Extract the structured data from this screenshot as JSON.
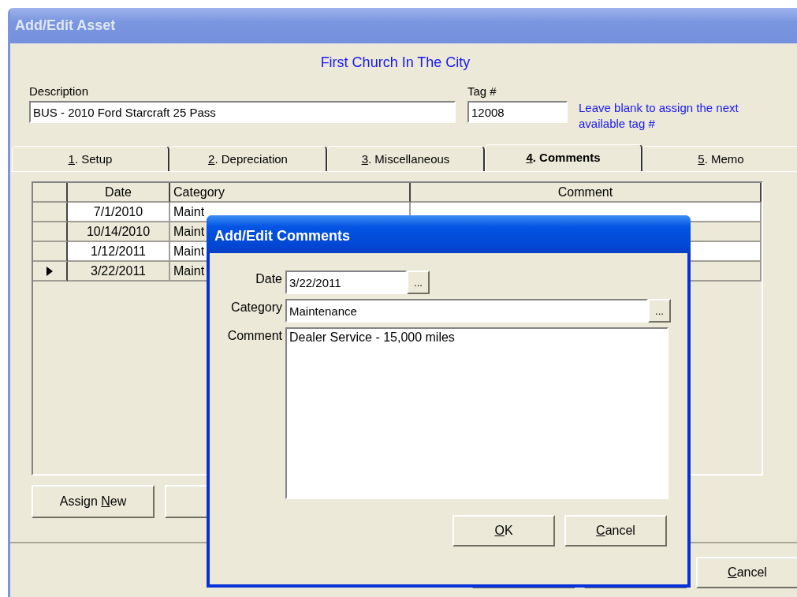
{
  "window": {
    "title": "Add/Edit Asset"
  },
  "organization": "First Church In The City",
  "description": {
    "label": "Description",
    "value": "BUS - 2010 Ford Starcraft 25 Pass"
  },
  "tag": {
    "label": "Tag #",
    "value": "12008",
    "hint": "Leave blank to assign the next available tag #"
  },
  "tabs": [
    {
      "key": "1",
      "post": ". Setup",
      "selected": false
    },
    {
      "key": "2",
      "post": ". Depreciation",
      "selected": false
    },
    {
      "key": "3",
      "post": ". Miscellaneous",
      "selected": false
    },
    {
      "key": "4",
      "post": ". Comments",
      "selected": true
    },
    {
      "key": "5",
      "post": ". Memo",
      "selected": false
    }
  ],
  "table": {
    "columns": [
      "Date",
      "Category",
      "Comment"
    ],
    "rows": [
      {
        "date": "7/1/2010",
        "category": "Maint",
        "current": false
      },
      {
        "date": "10/14/2010",
        "category": "Maint",
        "current": false
      },
      {
        "date": "1/12/2011",
        "category": "Maint",
        "current": false
      },
      {
        "date": "3/22/2011",
        "category": "Maint",
        "current": true
      }
    ]
  },
  "panel_buttons": [
    {
      "pre": "Assign ",
      "key": "N",
      "post": "ew"
    }
  ],
  "footer_buttons": [
    {
      "key": "C",
      "post": "ancel"
    }
  ],
  "dialog": {
    "title": "Add/Edit Comments",
    "date": {
      "label": "Date",
      "value": "3/22/2011",
      "button": "..."
    },
    "category": {
      "label": "Category",
      "value": "Maintenance",
      "button": "..."
    },
    "comment": {
      "label": "Comment",
      "value": "Dealer Service - 15,000 miles"
    },
    "buttons": [
      {
        "key": "O",
        "post": "K"
      },
      {
        "key": "C",
        "post": "ancel"
      }
    ]
  }
}
